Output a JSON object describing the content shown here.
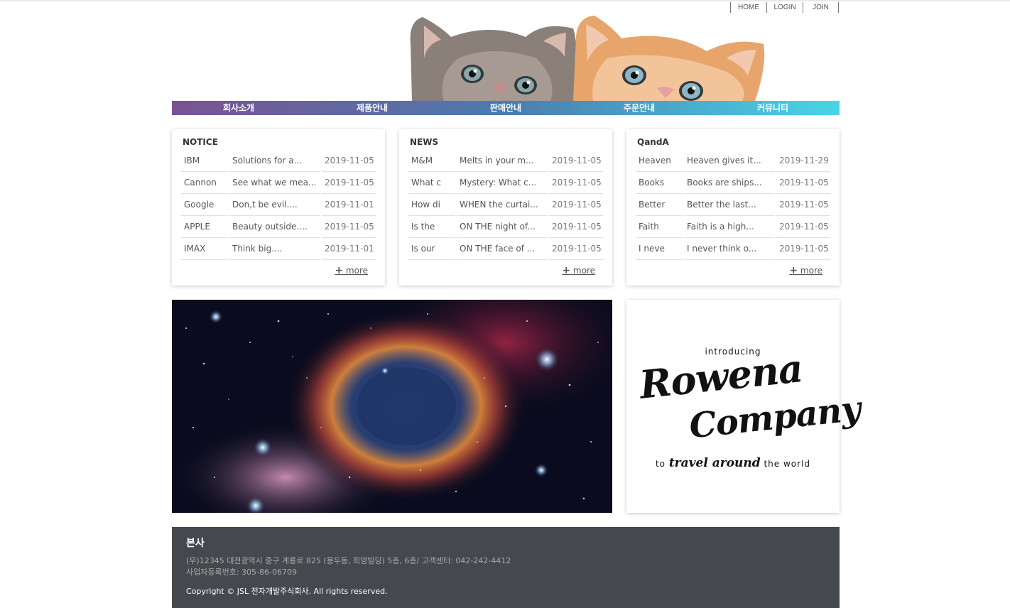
{
  "top_menu": {
    "home": "HOME",
    "login": "LOGIN",
    "join": "JOIN"
  },
  "gnb": [
    "회사소개",
    "제품안내",
    "판매안내",
    "주문안내",
    "커뮤니티"
  ],
  "boards": [
    {
      "title": "NOTICE",
      "rows": [
        [
          "IBM",
          "Solutions for a...",
          "2019-11-05"
        ],
        [
          "Cannon",
          "See what we mea...",
          "2019-11-05"
        ],
        [
          "Google",
          "Don,t be evil....",
          "2019-11-01"
        ],
        [
          "APPLE",
          "Beauty outside....",
          "2019-11-05"
        ],
        [
          "IMAX",
          "Think big....",
          "2019-11-01"
        ]
      ],
      "more": "more"
    },
    {
      "title": "NEWS",
      "rows": [
        [
          "M&M",
          "Melts in your m...",
          "2019-11-05"
        ],
        [
          "What c",
          "Mystery: What c...",
          "2019-11-05"
        ],
        [
          "How di",
          "WHEN the curtai...",
          "2019-11-05"
        ],
        [
          "Is the",
          "ON THE night of...",
          "2019-11-05"
        ],
        [
          "Is our",
          "ON THE face of ...",
          "2019-11-05"
        ]
      ],
      "more": "more"
    },
    {
      "title": "QandA",
      "rows": [
        [
          "Heaven",
          "Heaven gives it...",
          "2019-11-29"
        ],
        [
          "Books",
          "Books are ships...",
          "2019-11-05"
        ],
        [
          "Better",
          "Better the last...",
          "2019-11-05"
        ],
        [
          "Faith",
          "Faith is a high...",
          "2019-11-05"
        ],
        [
          "I neve",
          "I never think o...",
          "2019-11-05"
        ]
      ],
      "more": "more"
    }
  ],
  "promo": {
    "intro": "introducing",
    "brand_line1": "Rowena",
    "brand_line2": "Company",
    "tag_to": "to",
    "tag_travel": "travel around",
    "tag_world": "the world"
  },
  "footer": {
    "title": "본사",
    "address": "(우)12345 대전광역시 중구 계룡로 825 (용두동, 희영빌딩) 5층, 6층/ 고객센터: 042-242-4412",
    "business_no": "사업자등록번호: 305-86-06709",
    "copyright": "Copyright © JSL 전자개발주식회사. All rights reserved."
  }
}
